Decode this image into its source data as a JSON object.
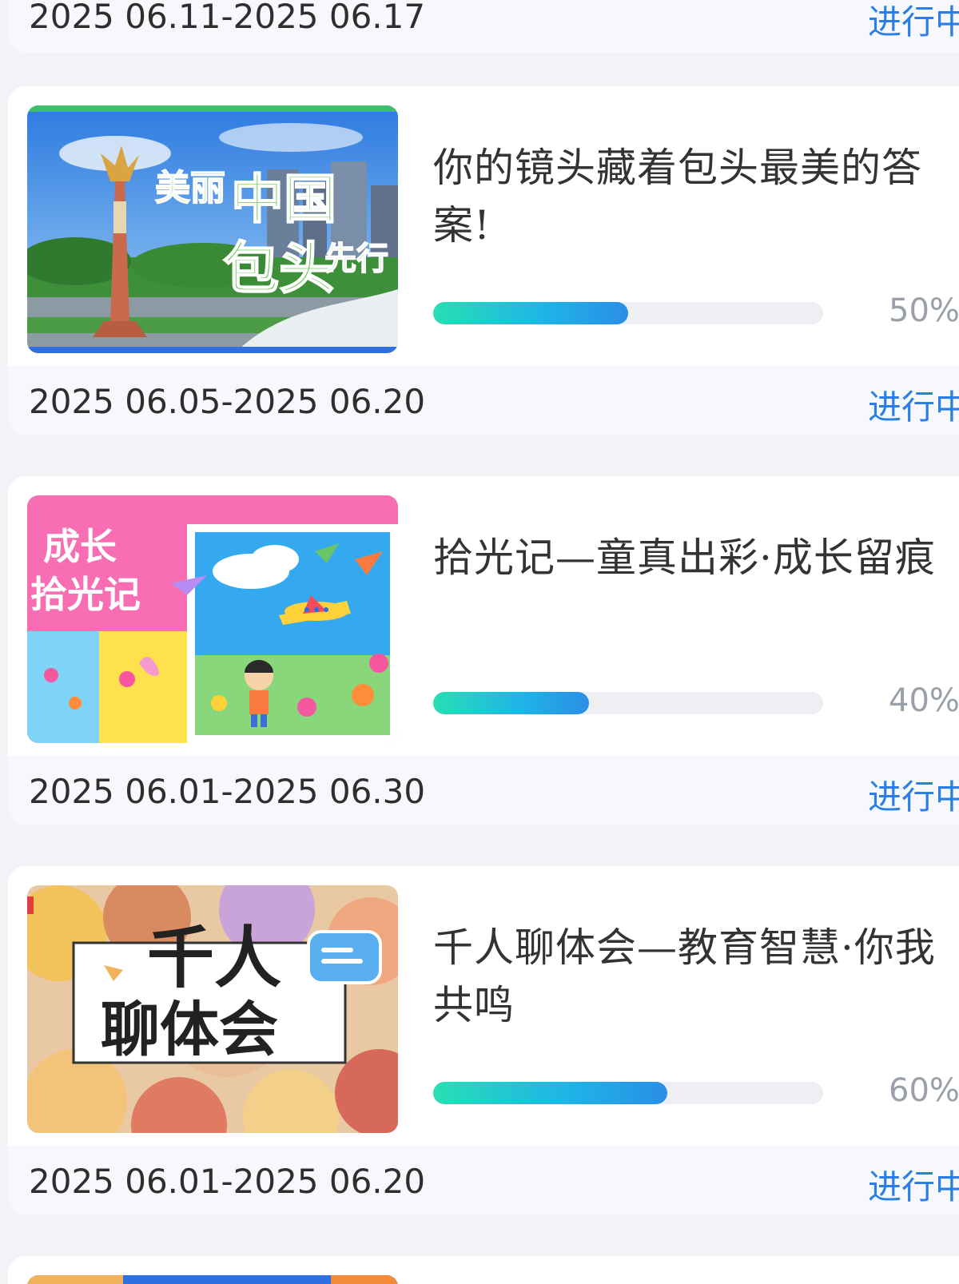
{
  "list": {
    "first_card_partial": {
      "date_range": "2025 06.11-2025 06.17",
      "status": "进行中"
    },
    "cards": [
      {
        "title": "你的镜头藏着包头最美的答案!",
        "progress": 0.5,
        "progress_label": "50%",
        "date_range": "2025 06.05-2025 06.20",
        "status": "进行中",
        "thumbnail_text": [
          "美丽",
          "中国",
          "包头",
          "先行"
        ]
      },
      {
        "title": "拾光记—童真出彩·成长留痕",
        "progress": 0.4,
        "progress_label": "40%",
        "date_range": "2025 06.01-2025 06.30",
        "status": "进行中",
        "thumbnail_text": [
          "成长",
          "拾光记"
        ]
      },
      {
        "title": "千人聊体会—教育智慧·你我共鸣",
        "progress": 0.6,
        "progress_label": "60%",
        "date_range": "2025 06.01-2025 06.20",
        "status": "进行中",
        "thumbnail_text": [
          "千人",
          "聊体会"
        ]
      }
    ]
  },
  "colors": {
    "status_blue": "#2b7ee6",
    "progress_start": "#27dfb3",
    "progress_end": "#2a8ee6",
    "track": "#eeeff3",
    "page_bg": "#f1f3f7"
  }
}
